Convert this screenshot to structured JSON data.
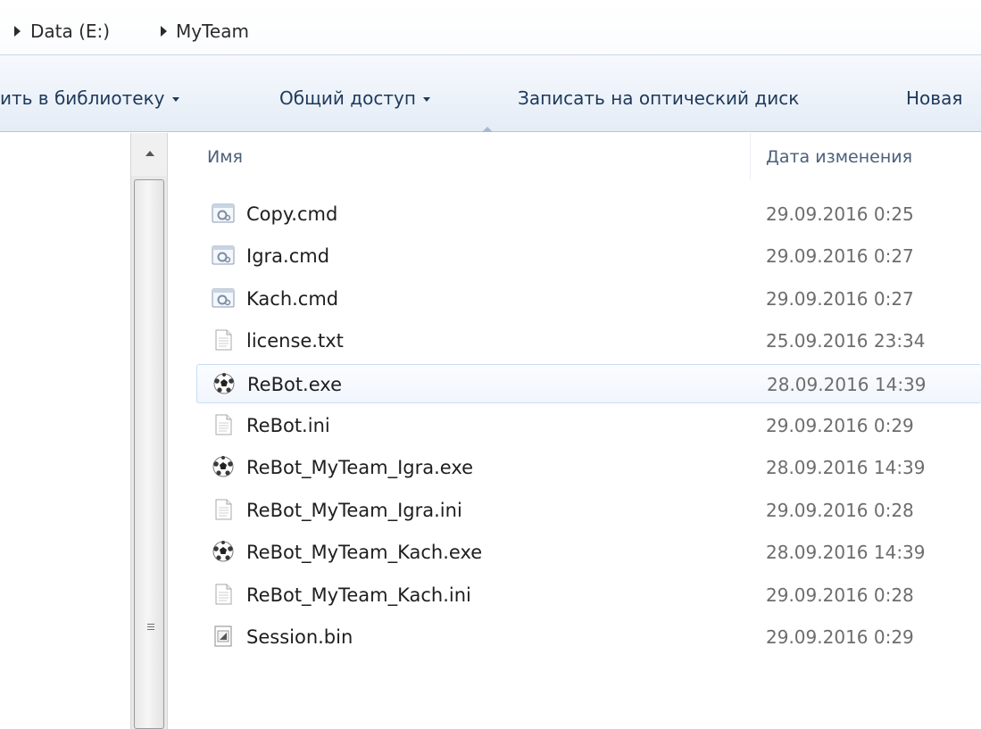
{
  "breadcrumb": {
    "items": [
      "Data (E:)",
      "MyTeam"
    ]
  },
  "toolbar": {
    "add_to_library": "ить в библиотеку",
    "share": "Общий доступ",
    "burn": "Записать на оптический диск",
    "new_folder": "Новая"
  },
  "columns": {
    "name": "Имя",
    "date_modified": "Дата изменения"
  },
  "files": [
    {
      "name": "Copy.cmd",
      "date": "29.09.2016 0:25",
      "icon": "cmd-script-icon"
    },
    {
      "name": "Igra.cmd",
      "date": "29.09.2016 0:27",
      "icon": "cmd-script-icon"
    },
    {
      "name": "Kach.cmd",
      "date": "29.09.2016 0:27",
      "icon": "cmd-script-icon"
    },
    {
      "name": "license.txt",
      "date": "25.09.2016 23:34",
      "icon": "text-file-icon"
    },
    {
      "name": "ReBot.exe",
      "date": "28.09.2016 14:39",
      "icon": "soccer-ball-exe-icon",
      "selected": true
    },
    {
      "name": "ReBot.ini",
      "date": "29.09.2016 0:29",
      "icon": "text-file-icon"
    },
    {
      "name": "ReBot_MyTeam_Igra.exe",
      "date": "28.09.2016 14:39",
      "icon": "soccer-ball-exe-icon"
    },
    {
      "name": "ReBot_MyTeam_Igra.ini",
      "date": "29.09.2016 0:28",
      "icon": "text-file-icon"
    },
    {
      "name": "ReBot_MyTeam_Kach.exe",
      "date": "28.09.2016 14:39",
      "icon": "soccer-ball-exe-icon"
    },
    {
      "name": "ReBot_MyTeam_Kach.ini",
      "date": "29.09.2016 0:28",
      "icon": "text-file-icon"
    },
    {
      "name": "Session.bin",
      "date": "29.09.2016 0:29",
      "icon": "binary-file-icon"
    }
  ],
  "colors": {
    "toolbar_text": "#1e395b",
    "selection_border": "#c7dcf3",
    "date_text": "#6d6d6d"
  }
}
